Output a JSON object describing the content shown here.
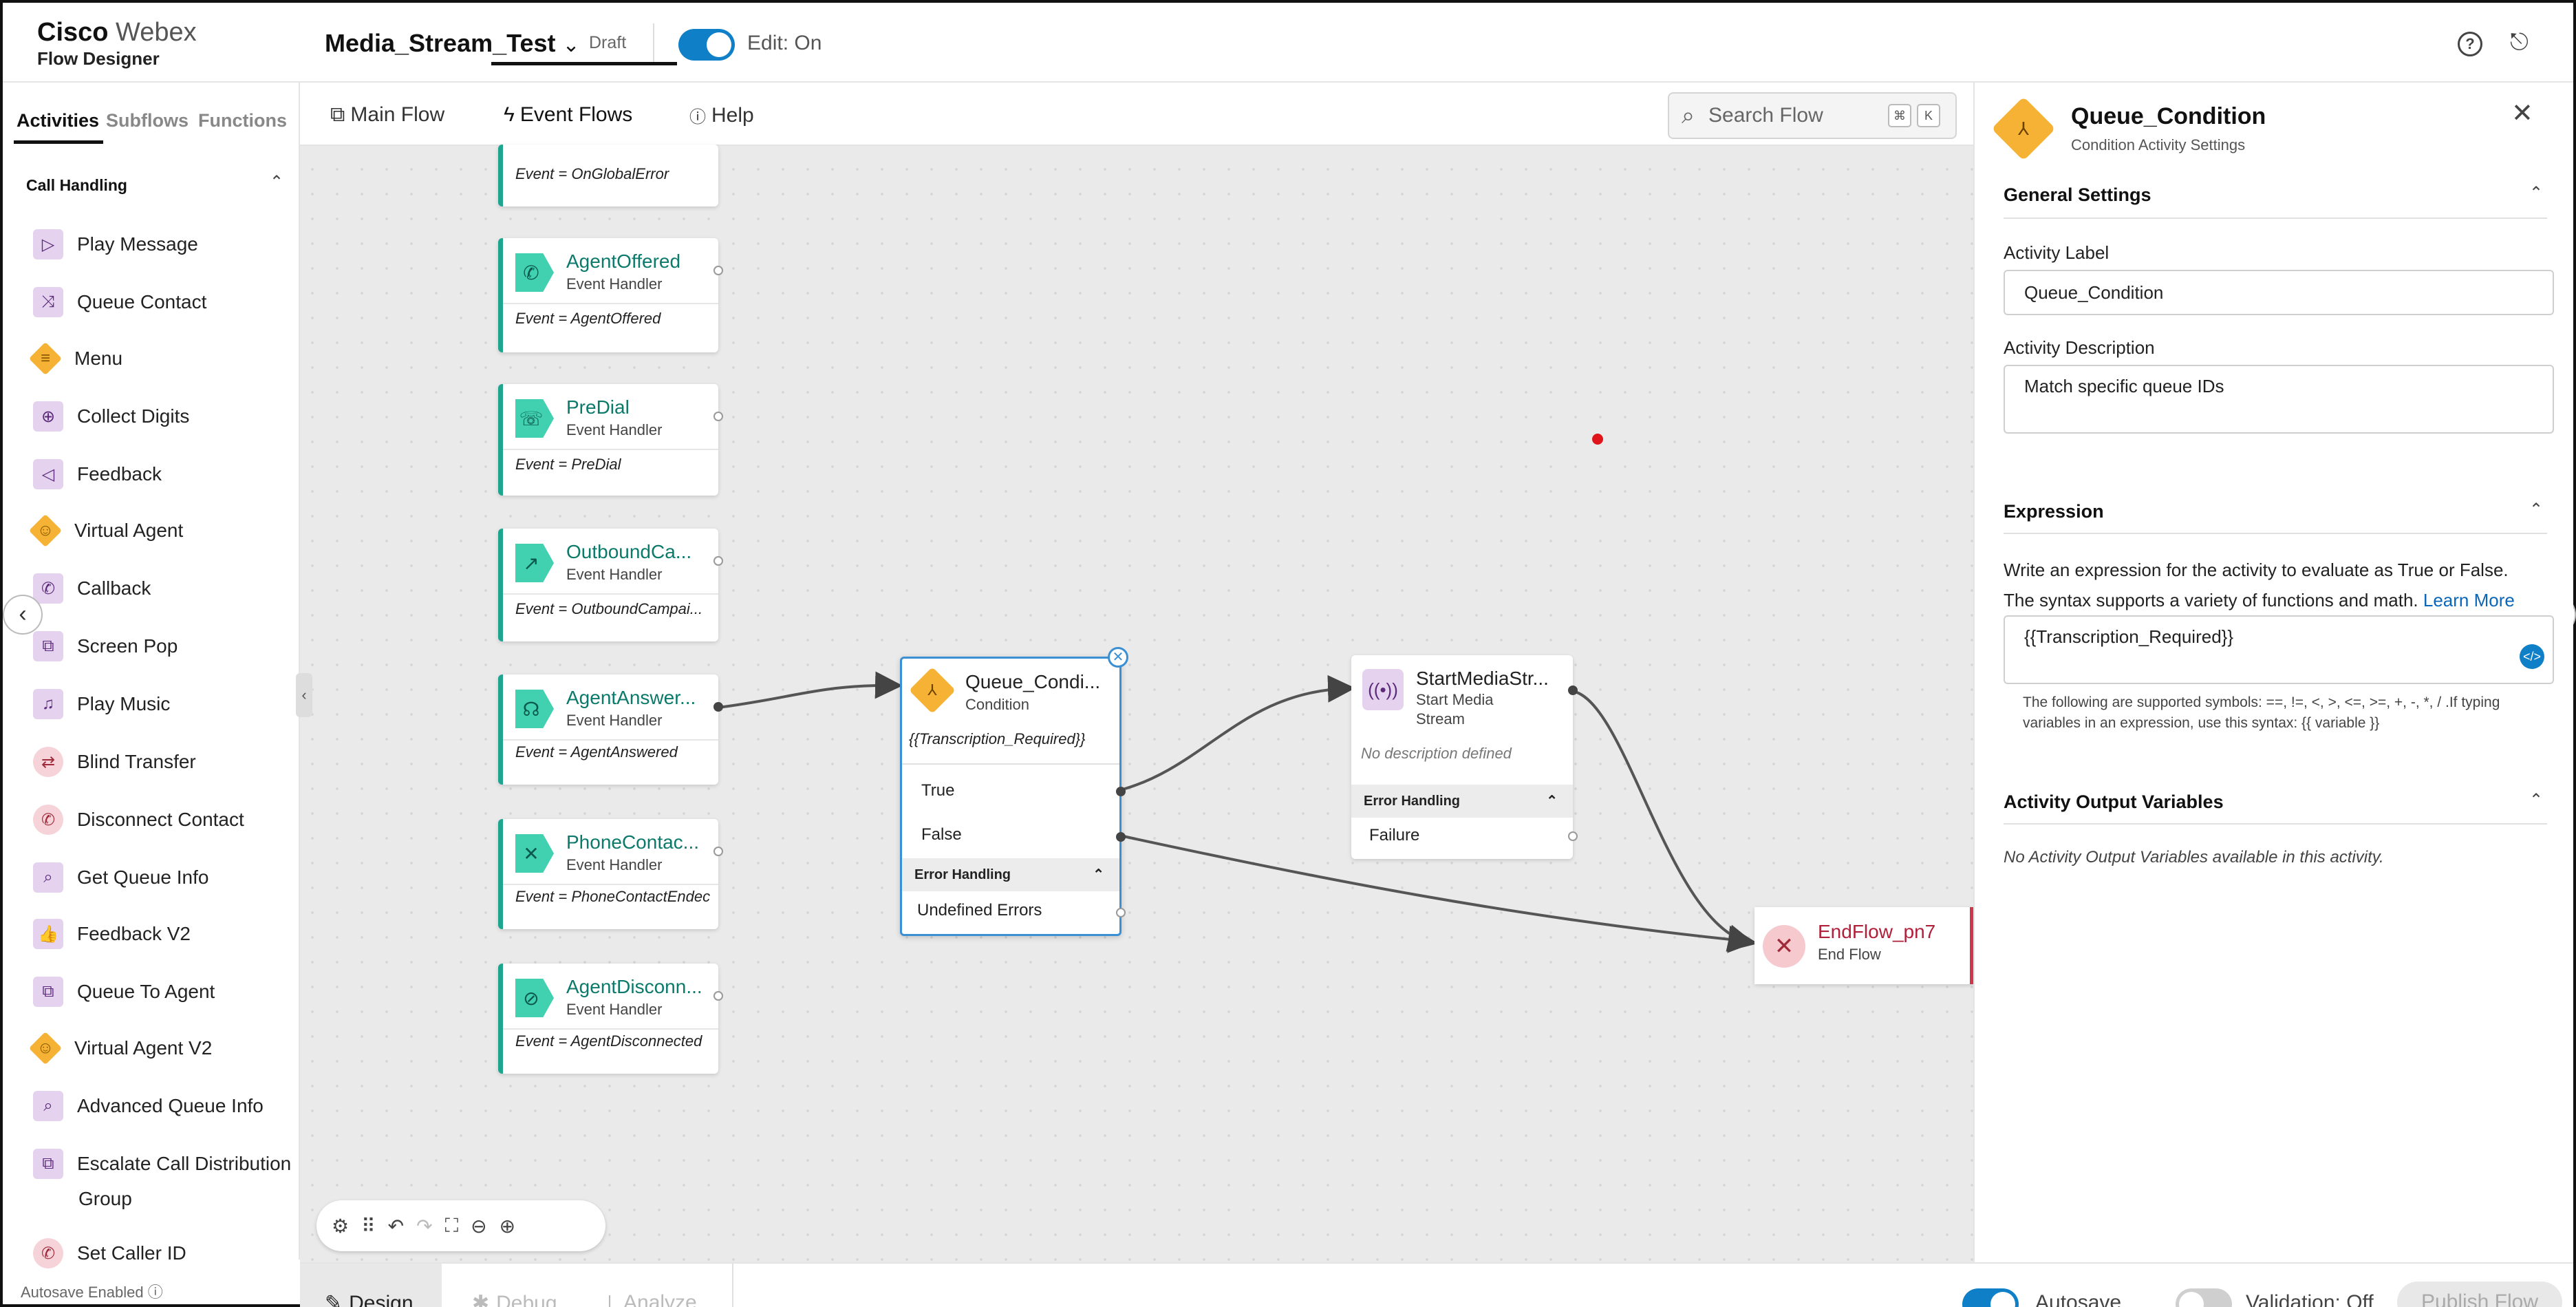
{
  "header": {
    "brand_main": "Cisco",
    "brand_product": "Webex",
    "brand_sub": "Flow Designer",
    "flow_name": "Media_Stream_Test",
    "draft": "Draft",
    "edit_label": "Edit: On",
    "help_icon": "question-circle-icon",
    "exit_icon": "exit-icon"
  },
  "left": {
    "tabs": [
      "Activities",
      "Subflows",
      "Functions"
    ],
    "category": "Call Handling",
    "activities": [
      {
        "label": "Play Message",
        "icon": "▷"
      },
      {
        "label": "Queue Contact",
        "icon": "⤨"
      },
      {
        "label": "Menu",
        "icon": "≡"
      },
      {
        "label": "Collect Digits",
        "icon": "⊕"
      },
      {
        "label": "Feedback",
        "icon": "◁"
      },
      {
        "label": "Virtual Agent",
        "icon": "☺"
      },
      {
        "label": "Callback",
        "icon": "✆"
      },
      {
        "label": "Screen Pop",
        "icon": "⧉"
      },
      {
        "label": "Play Music",
        "icon": "♫"
      },
      {
        "label": "Blind Transfer",
        "icon": "⇄"
      },
      {
        "label": "Disconnect Contact",
        "icon": "✆"
      },
      {
        "label": "Get Queue Info",
        "icon": "⌕"
      },
      {
        "label": "Feedback V2",
        "icon": "👍"
      },
      {
        "label": "Queue To Agent",
        "icon": "⧉"
      },
      {
        "label": "Virtual Agent V2",
        "icon": "☺"
      },
      {
        "label": "Advanced Queue Info",
        "icon": "⌕"
      },
      {
        "label": "Escalate Call Distribution",
        "icon": "⧉"
      },
      {
        "label": "Group",
        "icon": ""
      },
      {
        "label": "Set Caller ID",
        "icon": "✆"
      }
    ],
    "autosave": "Autosave Enabled"
  },
  "canvas_tabs": {
    "main": "Main Flow",
    "event": "Event Flows",
    "help": "Help"
  },
  "search": {
    "placeholder": "Search Flow",
    "k1": "⌘",
    "k2": "K"
  },
  "nodes": {
    "global_event": "Event = OnGlobalError",
    "agent_offered": {
      "title": "AgentOffered",
      "sub": "Event Handler",
      "event": "Event = AgentOffered"
    },
    "predial": {
      "title": "PreDial",
      "sub": "Event Handler",
      "event": "Event = PreDial"
    },
    "outbound": {
      "title": "OutboundCa...",
      "sub": "Event Handler",
      "event": "Event = OutboundCampai..."
    },
    "agent_answered": {
      "title": "AgentAnswer...",
      "sub": "Event Handler",
      "event": "Event = AgentAnswered"
    },
    "phone_contact": {
      "title": "PhoneContac...",
      "sub": "Event Handler",
      "event": "Event = PhoneContactEndec"
    },
    "agent_disconnected": {
      "title": "AgentDisconn...",
      "sub": "Event Handler",
      "event": "Event = AgentDisconnected"
    },
    "queue_condition": {
      "title": "Queue_Condi...",
      "sub": "Condition",
      "expr": "{{Transcription_Required}}",
      "true": "True",
      "false": "False",
      "error": "Error Handling",
      "undefined": "Undefined Errors"
    },
    "start_media": {
      "title": "StartMediaStr...",
      "sub1": "Start Media",
      "sub2": "Stream",
      "desc": "No description defined",
      "error": "Error Handling",
      "failure": "Failure"
    },
    "end_flow": {
      "title": "EndFlow_pn7",
      "sub": "End Flow"
    }
  },
  "bottom": {
    "tabs": [
      "Design",
      "Debug",
      "Analyze"
    ],
    "autosave": "Autosave",
    "validation": "Validation: Off",
    "publish": "Publish Flow"
  },
  "panel": {
    "title": "Queue_Condition",
    "subtitle": "Condition Activity Settings",
    "general": "General Settings",
    "label_label": "Activity Label",
    "label_value": "Queue_Condition",
    "desc_label": "Activity Description",
    "desc_value": "Match specific queue IDs",
    "expression": "Expression",
    "expr_help1": "Write an expression for the activity to evaluate as True or False.",
    "expr_help2": "The syntax supports a variety of functions and math.",
    "learn_more": "Learn More",
    "expr_value": "{{Transcription_Required}}",
    "symbols1": "The following are supported symbols: ==, !=, <, >, <=, >=, +, -, *, / .If typing",
    "symbols2": "variables in an expression, use this syntax: {{ variable }}",
    "output": "Activity Output Variables",
    "no_output": "No Activity Output Variables available in this activity."
  },
  "colors": {
    "accent": "#0f7fc7",
    "event_green": "#1da58e",
    "condition_orange": "#f5b234",
    "endflow_red": "#d1374c",
    "marker": "#e0141b"
  }
}
